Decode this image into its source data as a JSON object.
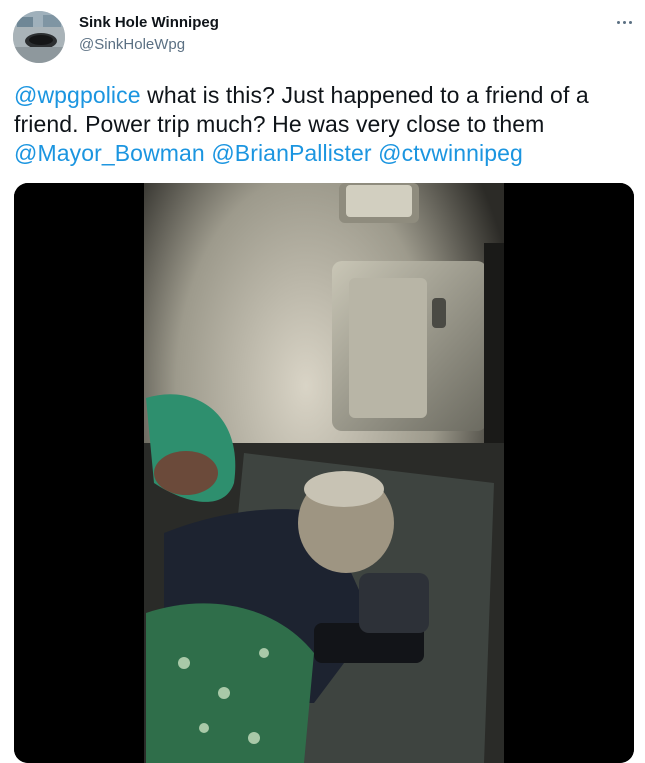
{
  "author": {
    "display_name": "Sink Hole Winnipeg",
    "handle": "@SinkHoleWpg",
    "avatar_icon": "sinkhole-avatar"
  },
  "more_icon": "more-options-icon",
  "tweet": {
    "mention_1": "@wpgpolice",
    "text_1": " what is this? Just happened to a friend of a friend. Power trip much? He was very close to them ",
    "mention_2": "@Mayor_Bowman",
    "mention_3": "@BrianPallister",
    "mention_4": "@ctvwinnipeg"
  },
  "colors": {
    "link": "#1b95e0",
    "secondary_text": "#5b7083",
    "primary_text": "#0f1419",
    "media_background": "#000000"
  },
  "media": {
    "type": "video-still",
    "description_icon": "video-frame-image"
  }
}
